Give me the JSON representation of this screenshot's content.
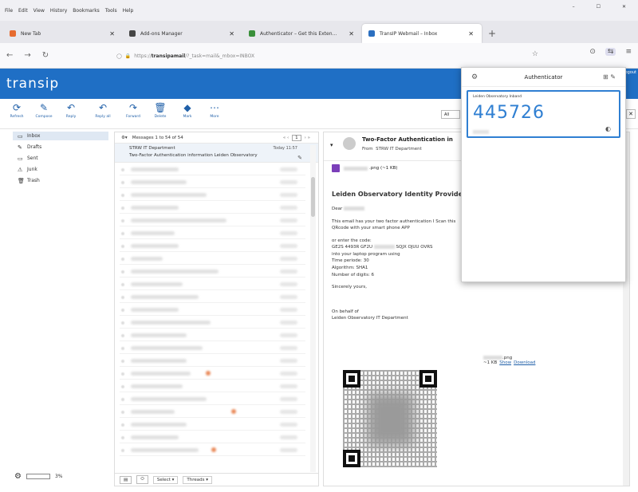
{
  "menubar": {
    "items": [
      "File",
      "Edit",
      "View",
      "History",
      "Bookmarks",
      "Tools",
      "Help"
    ],
    "controls": [
      "–",
      "☐",
      "✕"
    ]
  },
  "tabs": [
    {
      "label": "New Tab",
      "close": "✕",
      "color": "#e66b2f"
    },
    {
      "label": "Add-ons Manager",
      "close": "✕",
      "color": "#444"
    },
    {
      "label": "Authenticator – Get this Exten…",
      "close": "✕",
      "color": "#3a8f3a"
    },
    {
      "label": "TransIP Webmail – Inbox",
      "close": "✕",
      "color": "#2b6fc0"
    }
  ],
  "newtab": "+",
  "nav": {
    "back": "←",
    "forward": "→",
    "reload": "↻",
    "url_prefix": "https://",
    "url_host": "transipamail",
    "url_rest": "/?_task=mail&_mbox=INBOX",
    "star": "☆"
  },
  "tools": [
    "⊙",
    "⇆",
    "≡"
  ],
  "header": {
    "logo": "transip",
    "logout": "Logout"
  },
  "toolbar": [
    {
      "glyph": "⟳",
      "label": "Refresh"
    },
    {
      "glyph": "✎",
      "label": "Compose"
    },
    {
      "glyph": "↶",
      "label": "Reply"
    },
    {
      "glyph": "↶",
      "label": "Reply all"
    },
    {
      "glyph": "↷",
      "label": "Forward"
    },
    {
      "glyph": "🗑",
      "label": "Delete"
    },
    {
      "glyph": "◆",
      "label": "Mark"
    },
    {
      "glyph": "⋯",
      "label": "More"
    }
  ],
  "search_scope": "All",
  "folders": [
    {
      "icon": "▭",
      "label": "Inbox"
    },
    {
      "icon": "✎",
      "label": "Drafts"
    },
    {
      "icon": "▭",
      "label": "Sent"
    },
    {
      "icon": "⚠",
      "label": "Junk"
    },
    {
      "icon": "🗑",
      "label": "Trash"
    }
  ],
  "quota": {
    "gear": "⚙",
    "percent": "3%"
  },
  "list": {
    "header": "Messages 1 to 54 of 54",
    "page": "1",
    "first_msg": {
      "sender": "STRW IT Department",
      "date": "Today 11:57",
      "subject": "Two-Factor Authentication information Leiden Observatory"
    },
    "footer": {
      "select": "Select",
      "threads": "Threads"
    }
  },
  "preview": {
    "subject": "Two-Factor Authentication in",
    "from_label": "From",
    "from": "STRW IT Department",
    "attachment": ".png (~1 KB)",
    "heading": "Leiden Observatory Identity Provider",
    "dear": "Dear",
    "p1": "This email has your two factor authentication I Scan this QRcode with your smart phone APP",
    "p2a": "or enter the code:",
    "p2b": "GE2S 4493R GF2U",
    "p2c": "SQJX OJUU OVRS",
    "p2d": "into your laptop program using",
    "p2e": "Time periode: 30",
    "p2f": "Algorithm: SHA1",
    "p2g": "Number of digits: 6",
    "sincerely": "Sincerely yours,",
    "behalf": "On behalf of",
    "dept": "Leiden Observatory IT Department",
    "att_name": ".png",
    "att_size": "~1 KB",
    "show": "Show",
    "download": "Download"
  },
  "authenticator": {
    "title": "Authenticator",
    "issuer": "Leiden Observatory Inband",
    "code": "445726"
  }
}
